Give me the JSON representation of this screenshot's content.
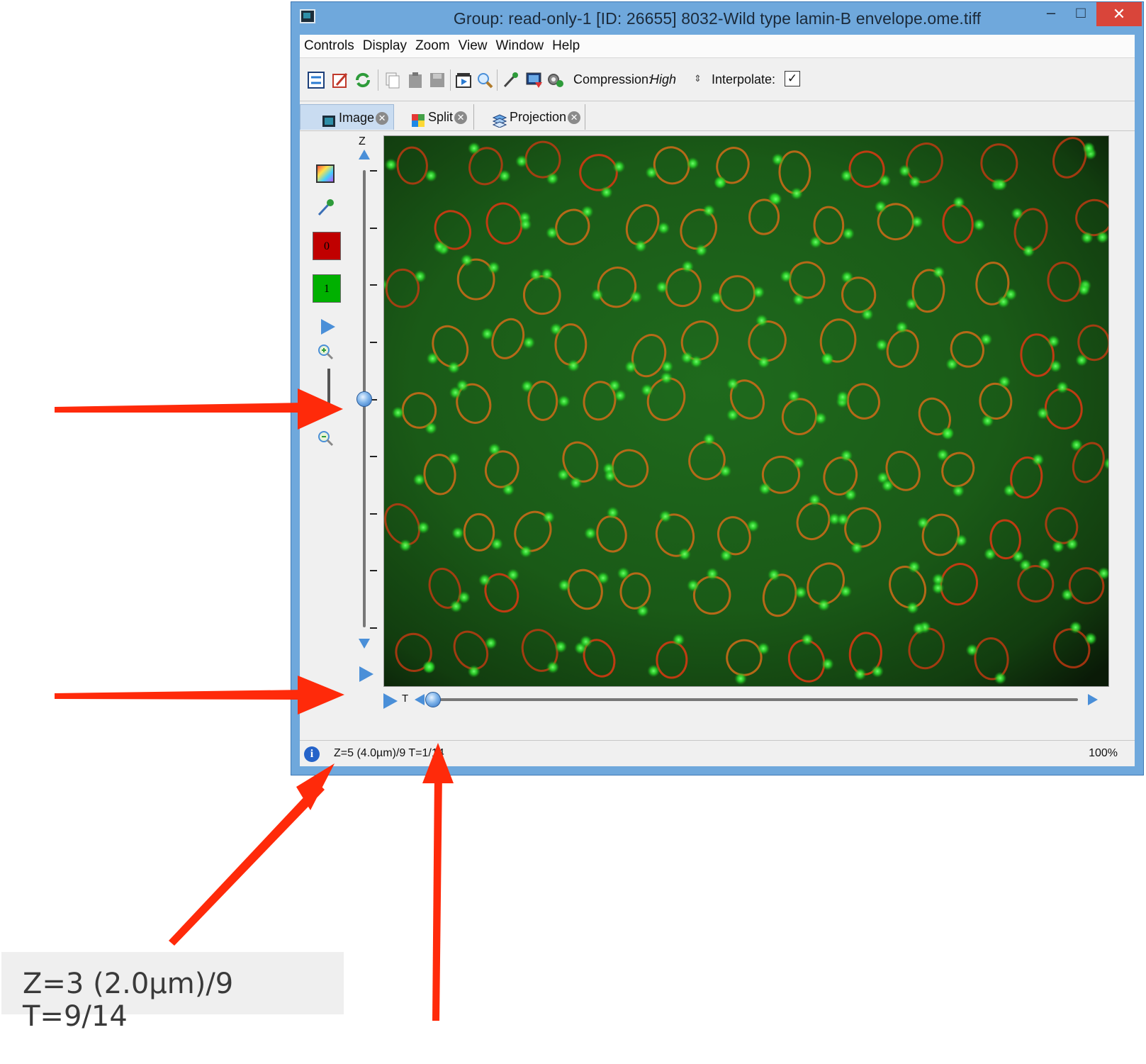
{
  "window": {
    "title": "Group: read-only-1 [ID: 26655] 8032-Wild type lamin-B envelope.ome.tiff",
    "minimize_glyph": "–",
    "maximize_glyph": "□",
    "close_glyph": "✕"
  },
  "menu": {
    "items": [
      "Controls",
      "Display",
      "Zoom",
      "View",
      "Window",
      "Help"
    ]
  },
  "toolbar": {
    "compression_label": "Compression:",
    "compression_value": "High",
    "interpolate_label": "Interpolate:",
    "interpolate_checked": true,
    "check_glyph": "✓",
    "spinner_glyph": "⇕",
    "icons": [
      "settings-icon",
      "edit-icon",
      "refresh-icon",
      "copy-icon",
      "paste-icon",
      "save-icon",
      "movie-icon",
      "magnifier-icon",
      "pipette-icon",
      "export-icon",
      "gears-icon"
    ]
  },
  "tabs": [
    {
      "label": "Image",
      "active": true
    },
    {
      "label": "Split",
      "active": false
    },
    {
      "label": "Projection",
      "active": false
    }
  ],
  "tab_close_glyph": "✕",
  "left_tools": {
    "channels": [
      {
        "label": "0",
        "color": "#c00000"
      },
      {
        "label": "1",
        "color": "#00b000"
      }
    ]
  },
  "z_slider": {
    "label": "Z",
    "value": 5,
    "max": 9
  },
  "t_slider": {
    "label": "T",
    "value": 1,
    "max": 14
  },
  "status": {
    "info_glyph": "i",
    "text": "Z=5 (4.0µm)/9 T=1/14",
    "zoom": "100%"
  },
  "callout": {
    "text": "Z=3 (2.0µm)/9 T=9/14"
  },
  "colors": {
    "title_bar": "#6fa8dc",
    "close_button": "#d9453a",
    "arrow": "#ff2a0a",
    "knob": "#4a8fd8"
  }
}
